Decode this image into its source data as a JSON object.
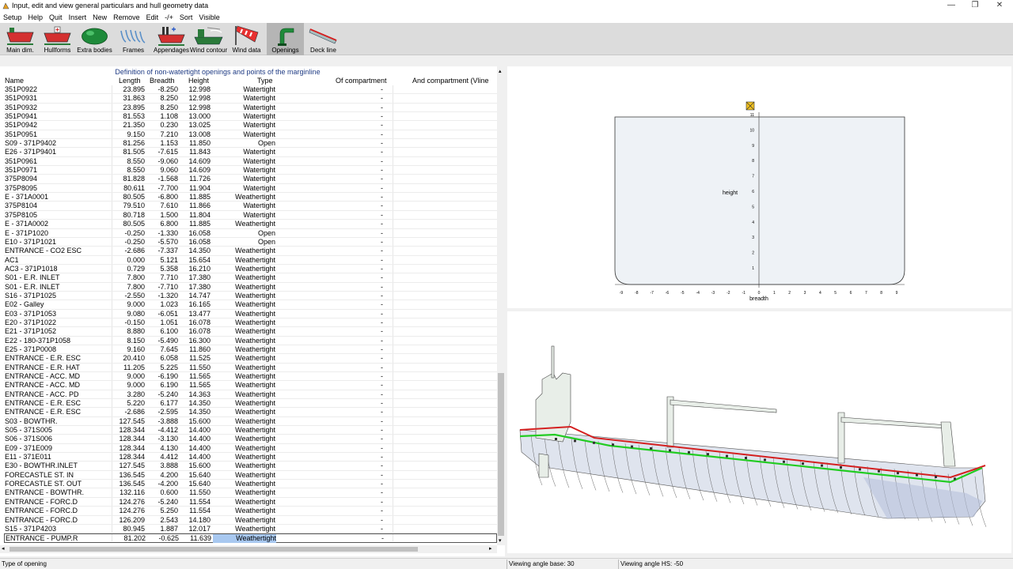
{
  "window": {
    "title": "Input, edit and view general particulars and hull geometry data"
  },
  "menu": [
    "Setup",
    "Help",
    "Quit",
    "Insert",
    "New",
    "Remove",
    "Edit",
    "-/+",
    "Sort",
    "Visible"
  ],
  "toolbar": [
    {
      "label": "Main dim.",
      "icon": "main-dimensions-icon",
      "active": false
    },
    {
      "label": "Hullforms",
      "icon": "hullforms-icon",
      "active": false
    },
    {
      "label": "Extra bodies",
      "icon": "extra-bodies-icon",
      "active": false
    },
    {
      "label": "Frames",
      "icon": "frames-icon",
      "active": false
    },
    {
      "label": "Appendages",
      "icon": "appendages-icon",
      "active": false
    },
    {
      "label": "Wind contour",
      "icon": "wind-contour-icon",
      "active": false
    },
    {
      "label": "Wind data",
      "icon": "wind-data-icon",
      "active": false
    },
    {
      "label": "Openings",
      "icon": "openings-icon",
      "active": true
    },
    {
      "label": "Deck line",
      "icon": "deck-line-icon",
      "active": false
    }
  ],
  "grid": {
    "caption": "Definition of non-watertight openings and points of the marginline",
    "headers": {
      "name": "Name",
      "length": "Length",
      "breadth": "Breadth",
      "height": "Height",
      "type": "Type",
      "of_compartment": "Of compartment",
      "and_compartment": "And compartment (Vline"
    },
    "rows": [
      [
        "351P0922",
        "23.895",
        "-8.250",
        "12.998",
        "Watertight",
        "-"
      ],
      [
        "351P0931",
        "31.863",
        "8.250",
        "12.998",
        "Watertight",
        "-"
      ],
      [
        "351P0932",
        "23.895",
        "8.250",
        "12.998",
        "Watertight",
        "-"
      ],
      [
        "351P0941",
        "81.553",
        "1.108",
        "13.000",
        "Watertight",
        "-"
      ],
      [
        "351P0942",
        "21.350",
        "0.230",
        "13.025",
        "Watertight",
        "-"
      ],
      [
        "351P0951",
        "9.150",
        "7.210",
        "13.008",
        "Watertight",
        "-"
      ],
      [
        "S09 - 371P9402",
        "81.256",
        "1.153",
        "11.850",
        "Open",
        "-"
      ],
      [
        "E26 - 371P9401",
        "81.505",
        "-7.615",
        "11.843",
        "Watertight",
        "-"
      ],
      [
        "351P0961",
        "8.550",
        "-9.060",
        "14.609",
        "Watertight",
        "-"
      ],
      [
        "351P0971",
        "8.550",
        "9.060",
        "14.609",
        "Watertight",
        "-"
      ],
      [
        "375P8094",
        "81.828",
        "-1.568",
        "11.726",
        "Watertight",
        "-"
      ],
      [
        "375P8095",
        "80.611",
        "-7.700",
        "11.904",
        "Watertight",
        "-"
      ],
      [
        "E  - 371A0001",
        "80.505",
        "-6.800",
        "11.885",
        "Weathertight",
        "-"
      ],
      [
        "375P8104",
        "79.510",
        "7.610",
        "11.866",
        "Watertight",
        "-"
      ],
      [
        "375P8105",
        "80.718",
        "1.500",
        "11.804",
        "Watertight",
        "-"
      ],
      [
        "E  - 371A0002",
        "80.505",
        "6.800",
        "11.885",
        "Weathertight",
        "-"
      ],
      [
        "E  - 371P1020",
        "-0.250",
        "-1.330",
        "16.058",
        "Open",
        "-"
      ],
      [
        "E10 - 371P1021",
        "-0.250",
        "-5.570",
        "16.058",
        "Open",
        "-"
      ],
      [
        "ENTRANCE - CO2  ESC",
        "-2.686",
        "-7.337",
        "14.350",
        "Weathertight",
        "-"
      ],
      [
        "AC1",
        "0.000",
        "5.121",
        "15.654",
        "Weathertight",
        "-"
      ],
      [
        "AC3 - 371P1018",
        "0.729",
        "5.358",
        "16.210",
        "Weathertight",
        "-"
      ],
      [
        "S01 - E.R. INLET",
        "7.800",
        "7.710",
        "17.380",
        "Weathertight",
        "-"
      ],
      [
        "S01 - E.R. INLET",
        "7.800",
        "-7.710",
        "17.380",
        "Weathertight",
        "-"
      ],
      [
        "S16 - 371P1025",
        "-2.550",
        "-1.320",
        "14.747",
        "Weathertight",
        "-"
      ],
      [
        "E02 - Galley",
        "9.000",
        "1.023",
        "16.165",
        "Weathertight",
        "-"
      ],
      [
        "E03 - 371P1053",
        "9.080",
        "-6.051",
        "13.477",
        "Weathertight",
        "-"
      ],
      [
        "E20 - 371P1022",
        "-0.150",
        "1.051",
        "16.078",
        "Weathertight",
        "-"
      ],
      [
        "E21 - 371P1052",
        "8.880",
        "6.100",
        "16.078",
        "Weathertight",
        "-"
      ],
      [
        "E22 - 180-371P1058",
        "8.150",
        "-5.490",
        "16.300",
        "Weathertight",
        "-"
      ],
      [
        "E25 - 371P0008",
        "9.160",
        "7.645",
        "11.860",
        "Weathertight",
        "-"
      ],
      [
        "ENTRANCE - E.R. ESC",
        "20.410",
        "6.058",
        "11.525",
        "Weathertight",
        "-"
      ],
      [
        "ENTRANCE - E.R. HAT",
        "11.205",
        "5.225",
        "11.550",
        "Weathertight",
        "-"
      ],
      [
        "ENTRANCE - ACC. MD",
        "9.000",
        "-6.190",
        "11.565",
        "Weathertight",
        "-"
      ],
      [
        "ENTRANCE - ACC. MD",
        "9.000",
        "6.190",
        "11.565",
        "Weathertight",
        "-"
      ],
      [
        "ENTRANCE - ACC. PD",
        "3.280",
        "-5.240",
        "14.363",
        "Weathertight",
        "-"
      ],
      [
        "ENTRANCE - E.R. ESC",
        "5.220",
        "6.177",
        "14.350",
        "Weathertight",
        "-"
      ],
      [
        "ENTRANCE - E.R. ESC",
        "-2.686",
        "-2.595",
        "14.350",
        "Weathertight",
        "-"
      ],
      [
        "S03 - BOWTHR.",
        "127.545",
        "-3.888",
        "15.600",
        "Weathertight",
        "-"
      ],
      [
        "S05 - 371S005",
        "128.344",
        "-4.412",
        "14.400",
        "Weathertight",
        "-"
      ],
      [
        "S06 - 371S006",
        "128.344",
        "-3.130",
        "14.400",
        "Weathertight",
        "-"
      ],
      [
        "E09 - 371E009",
        "128.344",
        "4.130",
        "14.400",
        "Weathertight",
        "-"
      ],
      [
        "E11 - 371E011",
        "128.344",
        "4.412",
        "14.400",
        "Weathertight",
        "-"
      ],
      [
        "E30 - BOWTHR.INLET",
        "127.545",
        "3.888",
        "15.600",
        "Weathertight",
        "-"
      ],
      [
        "FORECASTLE ST. IN",
        "136.545",
        "4.200",
        "15.640",
        "Weathertight",
        "-"
      ],
      [
        "FORECASTLE ST. OUT",
        "136.545",
        "-4.200",
        "15.640",
        "Weathertight",
        "-"
      ],
      [
        "ENTRANCE - BOWTHR.",
        "132.116",
        "0.600",
        "11.550",
        "Weathertight",
        "-"
      ],
      [
        "ENTRANCE - FORC.D",
        "124.276",
        "-5.240",
        "11.554",
        "Weathertight",
        "-"
      ],
      [
        "ENTRANCE - FORC.D",
        "124.276",
        "5.250",
        "11.554",
        "Weathertight",
        "-"
      ],
      [
        "ENTRANCE - FORC.D",
        "126.209",
        "2.543",
        "14.180",
        "Weathertight",
        "-"
      ],
      [
        "S15 - 371P4203",
        "80.945",
        "1.887",
        "12.017",
        "Weathertight",
        "-"
      ],
      [
        "ENTRANCE - PUMP.R",
        "81.202",
        "-0.625",
        "11.639",
        "Weathertight",
        "-"
      ]
    ]
  },
  "section_view": {
    "xlabel": "breadth",
    "ylabel": "height",
    "x_ticks": [
      "-9",
      "-8",
      "-7",
      "-6",
      "-5",
      "-4",
      "-3",
      "-2",
      "-1",
      "0",
      "1",
      "2",
      "3",
      "4",
      "5",
      "6",
      "7",
      "8",
      "9"
    ],
    "y_ticks": [
      "1",
      "2",
      "3",
      "4",
      "5",
      "6",
      "7",
      "8",
      "9",
      "10",
      "11"
    ]
  },
  "status": {
    "hint": "Type of opening",
    "base_angle": "Viewing angle base: 30",
    "hs_angle": "Viewing angle HS: -50"
  },
  "colors": {
    "accent": "#1f3b84",
    "selection": "#a8c8f0",
    "marginline": "#d42020",
    "deckline": "#22cc22"
  }
}
